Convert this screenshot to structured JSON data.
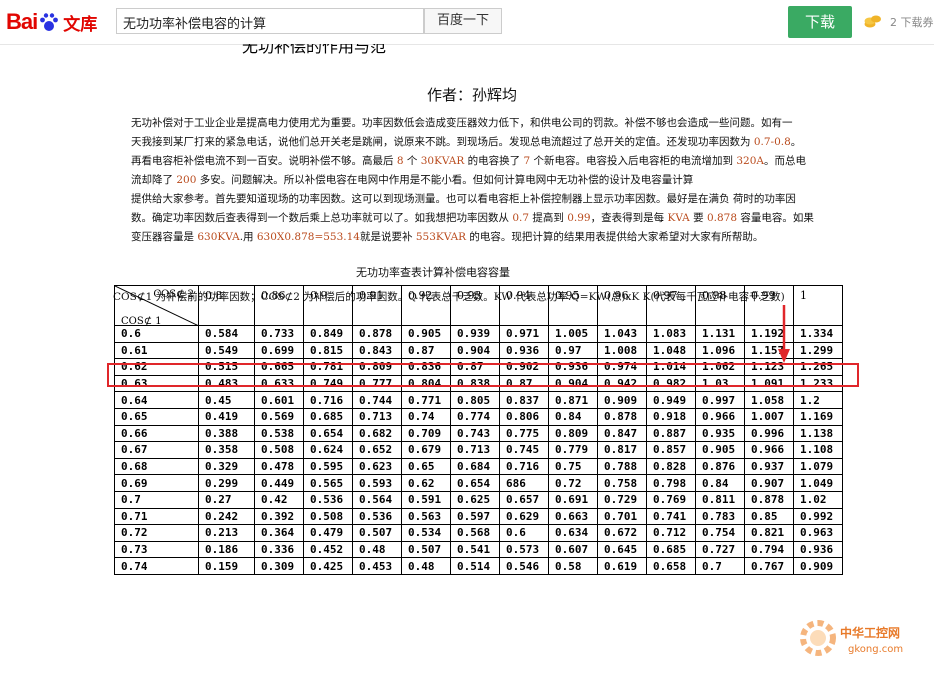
{
  "header": {
    "logo_bai": "Bai",
    "logo_du": "du",
    "logo_wenku": "文库",
    "search_value": "无功功率补偿电容的计算",
    "search_button": "百度一下",
    "download_button": "下载",
    "download_count": "2 下载券"
  },
  "document": {
    "cut_title": "无功补偿的作用与范",
    "author": "作者：孙辉均",
    "para_lines": [
      [
        "无功补偿对于工业企业是提高电力使用尤为重要。功率因数低会造成变压器效力低下，和供电公司的罚款。补偿不够也会造成一些问题。如有一"
      ],
      [
        "天我接到某厂打来的紧急电话，说他们总开关老是跳闸，说原来不跳。到现场后。发现总电流超过了总开关的定值。还发现功率因数为 ",
        "0.7-0.8",
        "。"
      ],
      [
        "再看电容柜补偿电流不到一百安。说明补偿不够。高最后 ",
        "8",
        " 个 ",
        "30KVAR",
        " 的电容换了 ",
        "7",
        " 个新电容。电容投入后电容柜的电流增加到 ",
        "320A",
        "。而总电"
      ],
      [
        "流却降了 ",
        "200",
        " 多安。问题解决。所以补偿电容在电网中作用是不能小看。但如何计算电网中无功补偿的设计及电容量计算"
      ],
      [
        "提供给大家参考。首先要知道现场的功率因数。这可以到现场测量。也可以看电容柜上补偿控制器上显示功率因数。最好是在满负 荷时的功率因"
      ],
      [
        "数。确定功率因数后查表得到一个数后乘上总功率就可以了。如我想把功率因数从 ",
        "0.7",
        " 提高到 ",
        "0.99",
        "，查表得到是每 ",
        "KVA",
        " 要 ",
        "0.878",
        " 容量电容。如果"
      ],
      [
        "变压器容量是 ",
        "630KVA",
        ".用 ",
        "630X0.878=553.14",
        "就是说要补 ",
        "553KVAR",
        " 的电容。现把计算的结果用表提供给大家希望对大家有所帮助。"
      ]
    ],
    "table_title": "无功功率查表计算补偿电容容量",
    "table_desc": "COS⊄1 为补偿前的功率因数；COS⊄2 为补偿后的功率因数。Q 代表总千乏数。KW 代表总功率.Q=KW(总)xK     K(代表每千瓦应补电容千乏数)"
  },
  "table": {
    "corner_top": "COS⊄ 2",
    "corner_bottom": "COS⊄ 1",
    "columns": [
      "0.8",
      "0.86",
      "0.9",
      "0.91",
      "0.92",
      "0.93",
      "0.94",
      "0.95",
      "0.96",
      "0.97",
      "0.98",
      "0.99",
      "1"
    ],
    "rows": [
      {
        "label": "0.6",
        "values": [
          "0.584",
          "0.733",
          "0.849",
          "0.878",
          "0.905",
          "0.939",
          "0.971",
          "1.005",
          "1.043",
          "1.083",
          "1.131",
          "1.192",
          "1.334"
        ]
      },
      {
        "label": "0.61",
        "values": [
          "0.549",
          "0.699",
          "0.815",
          "0.843",
          "0.87",
          "0.904",
          "0.936",
          "0.97",
          "1.008",
          "1.048",
          "1.096",
          "1.157",
          "1.299"
        ]
      },
      {
        "label": "0.62",
        "values": [
          "0.515",
          "0.665",
          "0.781",
          "0.809",
          "0.836",
          "0.87",
          "0.902",
          "0.936",
          "0.974",
          "1.014",
          "1.062",
          "1.123",
          "1.265"
        ]
      },
      {
        "label": "0.63",
        "values": [
          "0.483",
          "0.633",
          "0.749",
          "0.777",
          "0.804",
          "0.838",
          "0.87",
          "0.904",
          "0.942",
          "0.982",
          "1.03",
          "1.091",
          "1.233"
        ]
      },
      {
        "label": "0.64",
        "values": [
          "0.45",
          "0.601",
          "0.716",
          "0.744",
          "0.771",
          "0.805",
          "0.837",
          "0.871",
          "0.909",
          "0.949",
          "0.997",
          "1.058",
          "1.2"
        ]
      },
      {
        "label": "0.65",
        "values": [
          "0.419",
          "0.569",
          "0.685",
          "0.713",
          "0.74",
          "0.774",
          "0.806",
          "0.84",
          "0.878",
          "0.918",
          "0.966",
          "1.007",
          "1.169"
        ]
      },
      {
        "label": "0.66",
        "values": [
          "0.388",
          "0.538",
          "0.654",
          "0.682",
          "0.709",
          "0.743",
          "0.775",
          "0.809",
          "0.847",
          "0.887",
          "0.935",
          "0.996",
          "1.138"
        ]
      },
      {
        "label": "0.67",
        "values": [
          "0.358",
          "0.508",
          "0.624",
          "0.652",
          "0.679",
          "0.713",
          "0.745",
          "0.779",
          "0.817",
          "0.857",
          "0.905",
          "0.966",
          "1.108"
        ]
      },
      {
        "label": "0.68",
        "values": [
          "0.329",
          "0.478",
          "0.595",
          "0.623",
          "0.65",
          "0.684",
          "0.716",
          "0.75",
          "0.788",
          "0.828",
          "0.876",
          "0.937",
          "1.079"
        ]
      },
      {
        "label": "0.69",
        "values": [
          "0.299",
          "0.449",
          "0.565",
          "0.593",
          "0.62",
          "0.654",
          "686",
          "0.72",
          "0.758",
          "0.798",
          "0.84",
          "0.907",
          "1.049"
        ]
      },
      {
        "label": "0.7",
        "values": [
          "0.27",
          "0.42",
          "0.536",
          "0.564",
          "0.591",
          "0.625",
          "0.657",
          "0.691",
          "0.729",
          "0.769",
          "0.811",
          "0.878",
          "1.02"
        ]
      },
      {
        "label": "0.71",
        "values": [
          "0.242",
          "0.392",
          "0.508",
          "0.536",
          "0.563",
          "0.597",
          "0.629",
          "0.663",
          "0.701",
          "0.741",
          "0.783",
          "0.85",
          "0.992"
        ]
      },
      {
        "label": "0.72",
        "values": [
          "0.213",
          "0.364",
          "0.479",
          "0.507",
          "0.534",
          "0.568",
          "0.6",
          "0.634",
          "0.672",
          "0.712",
          "0.754",
          "0.821",
          "0.963"
        ]
      },
      {
        "label": "0.73",
        "values": [
          "0.186",
          "0.336",
          "0.452",
          "0.48",
          "0.507",
          "0.541",
          "0.573",
          "0.607",
          "0.645",
          "0.685",
          "0.727",
          "0.794",
          "0.936"
        ]
      },
      {
        "label": "0.74",
        "values": [
          "0.159",
          "0.309",
          "0.425",
          "0.453",
          "0.48",
          "0.514",
          "0.546",
          "0.58",
          "0.619",
          "0.658",
          "0.7",
          "0.767",
          "0.909"
        ]
      }
    ]
  },
  "watermark": {
    "name": "中华工控网",
    "url": "gkong.com"
  },
  "colors": {
    "brand_red": "#e10601",
    "download_green": "#3aaa63",
    "highlight_box": "#e0262a",
    "number_highlight": "#b94a1c",
    "watermark_orange": "#e87a2a"
  }
}
